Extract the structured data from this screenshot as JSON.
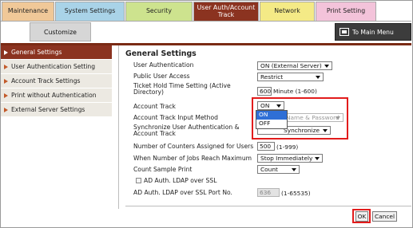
{
  "tabs": [
    {
      "label": "Maintenance",
      "bg": "#f0c898"
    },
    {
      "label": "System Settings",
      "bg": "#a9d3e8"
    },
    {
      "label": "Security",
      "bg": "#cde38e"
    },
    {
      "label": "User Auth/Account Track",
      "bg": "#8b3320"
    },
    {
      "label": "Network",
      "bg": "#f4ea86"
    },
    {
      "label": "Print Setting",
      "bg": "#f3c3da"
    }
  ],
  "subtab": {
    "label": "Customize"
  },
  "main_menu": {
    "label": "To Main Menu"
  },
  "sidebar": {
    "items": [
      {
        "label": "General Settings",
        "active": true
      },
      {
        "label": "User Authentication Setting",
        "active": false
      },
      {
        "label": "Account Track Settings",
        "active": false
      },
      {
        "label": "Print without Authentication",
        "active": false
      },
      {
        "label": "External Server Settings",
        "active": false
      }
    ]
  },
  "content": {
    "title": "General Settings",
    "fields": {
      "user_auth": {
        "label": "User Authentication",
        "value": "ON (External Server)"
      },
      "public_access": {
        "label": "Public User Access",
        "value": "Restrict"
      },
      "ticket_hold": {
        "label": "Ticket Hold Time Setting (Active Directory)",
        "value": "600",
        "unit": "Minute (1-600)"
      },
      "account_track": {
        "label": "Account Track",
        "value": "ON"
      },
      "account_track_input": {
        "label": "Account Track Input Method",
        "value": "Name & Password"
      },
      "sync": {
        "label": "Synchronize User Authentication & Account Track",
        "value": "Synchronize"
      },
      "counters": {
        "label": "Number of Counters Assigned for Users",
        "value": "500",
        "unit": "(1-999)"
      },
      "jobs_max": {
        "label": "When Number of Jobs Reach Maximum",
        "value": "Stop Immediately"
      },
      "count_sample": {
        "label": "Count Sample Print",
        "value": "Count"
      },
      "ldap_ssl": {
        "label": "AD Auth. LDAP over SSL"
      },
      "ldap_port": {
        "label": "AD Auth. LDAP over SSL Port No.",
        "value": "636",
        "unit": "(1-65535)"
      }
    },
    "account_track_options": [
      "ON",
      "OFF"
    ]
  },
  "buttons": {
    "ok": "OK",
    "cancel": "Cancel"
  },
  "colors": {
    "accent": "#8b3320",
    "highlight": "#e21c1c"
  }
}
